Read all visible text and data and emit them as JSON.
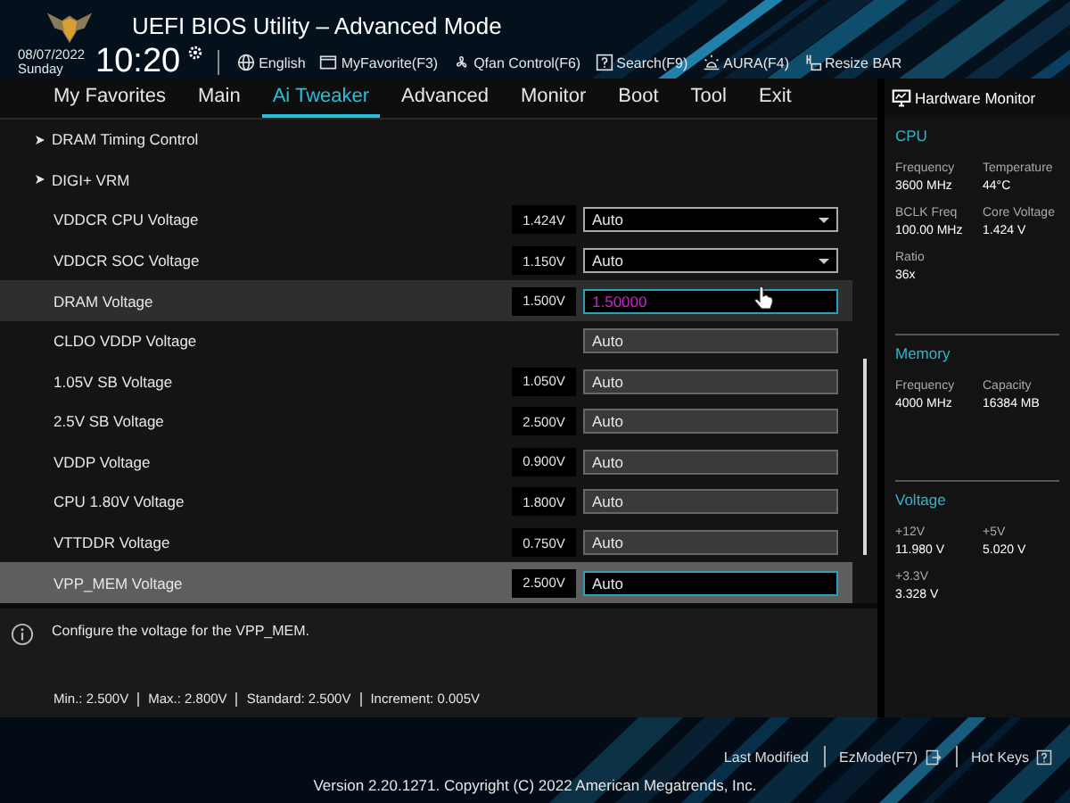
{
  "header": {
    "title": "UEFI BIOS Utility – Advanced Mode",
    "date": "08/07/2022",
    "day": "Sunday",
    "time": "10:20",
    "tools": [
      {
        "kind": "globe",
        "label": "English"
      },
      {
        "kind": "favorite",
        "label": "MyFavorite(F3)"
      },
      {
        "kind": "fan",
        "label": "Qfan Control(F6)"
      },
      {
        "kind": "search",
        "label": "Search(F9)"
      },
      {
        "kind": "aura",
        "label": "AURA(F4)"
      },
      {
        "kind": "bar",
        "label": "Resize BAR"
      }
    ]
  },
  "tabs": [
    {
      "label": "My Favorites",
      "selected": false
    },
    {
      "label": "Main",
      "selected": false
    },
    {
      "label": "Ai Tweaker",
      "selected": true
    },
    {
      "label": "Advanced",
      "selected": false
    },
    {
      "label": "Monitor",
      "selected": false
    },
    {
      "label": "Boot",
      "selected": false
    },
    {
      "label": "Tool",
      "selected": false
    },
    {
      "label": "Exit",
      "selected": false
    }
  ],
  "settings": [
    {
      "kind": "submenu",
      "label": "DRAM Timing Control"
    },
    {
      "kind": "submenu",
      "label": "DIGI+ VRM"
    },
    {
      "kind": "dropdown",
      "label": "VDDCR CPU Voltage",
      "reading": "1.424V",
      "value": "Auto",
      "selected": false,
      "hovered": false
    },
    {
      "kind": "dropdown",
      "label": "VDDCR SOC Voltage",
      "reading": "1.150V",
      "value": "Auto",
      "selected": false,
      "hovered": false
    },
    {
      "kind": "field",
      "label": "DRAM Voltage",
      "reading": "1.500V",
      "value": "1.50000",
      "selected": false,
      "hovered": true,
      "editing": true
    },
    {
      "kind": "field",
      "label": "CLDO VDDP Voltage",
      "value": "Auto",
      "selected": false,
      "hovered": false,
      "editing": false
    },
    {
      "kind": "field",
      "label": "1.05V SB Voltage",
      "reading": "1.050V",
      "value": "Auto",
      "selected": false,
      "hovered": false,
      "editing": false
    },
    {
      "kind": "field",
      "label": "2.5V SB Voltage",
      "reading": "2.500V",
      "value": "Auto",
      "selected": false,
      "hovered": false,
      "editing": false
    },
    {
      "kind": "field",
      "label": "VDDP Voltage",
      "reading": "0.900V",
      "value": "Auto",
      "selected": false,
      "hovered": false,
      "editing": false
    },
    {
      "kind": "field",
      "label": "CPU 1.80V Voltage",
      "reading": "1.800V",
      "value": "Auto",
      "selected": false,
      "hovered": false,
      "editing": false
    },
    {
      "kind": "field",
      "label": "VTTDDR Voltage",
      "reading": "0.750V",
      "value": "Auto",
      "selected": false,
      "hovered": false,
      "editing": false
    },
    {
      "kind": "field",
      "label": "VPP_MEM Voltage",
      "reading": "2.500V",
      "value": "Auto",
      "selected": true,
      "hovered": false,
      "editing": false
    }
  ],
  "info": {
    "description": "Configure the voltage for the VPP_MEM.",
    "limits": [
      "Min.: 2.500V",
      "Max.: 2.800V",
      "Standard: 2.500V",
      "Increment: 0.005V"
    ]
  },
  "hardware_monitor": {
    "title": "Hardware Monitor",
    "sections": [
      {
        "title": "CPU",
        "items": [
          {
            "label": "Frequency",
            "value": "3600 MHz"
          },
          {
            "label": "Temperature",
            "value": "44°C"
          },
          {
            "label": "BCLK Freq",
            "value": "100.00 MHz"
          },
          {
            "label": "Core Voltage",
            "value": "1.424 V"
          },
          {
            "label": "Ratio",
            "value": "36x"
          }
        ]
      },
      {
        "title": "Memory",
        "items": [
          {
            "label": "Frequency",
            "value": "4000 MHz"
          },
          {
            "label": "Capacity",
            "value": "16384 MB"
          }
        ]
      },
      {
        "title": "Voltage",
        "items": [
          {
            "label": "+12V",
            "value": "11.980 V"
          },
          {
            "label": "+5V",
            "value": "5.020 V"
          },
          {
            "label": "+3.3V",
            "value": "3.328 V"
          }
        ]
      }
    ]
  },
  "footer": {
    "links": [
      {
        "kind": "text",
        "label": "Last Modified"
      },
      {
        "kind": "ezmode",
        "label": "EzMode(F7)"
      },
      {
        "kind": "hotkeys",
        "label": "Hot Keys"
      }
    ],
    "copyright": "Version 2.20.1271. Copyright (C) 2022 American Megatrends, Inc."
  }
}
